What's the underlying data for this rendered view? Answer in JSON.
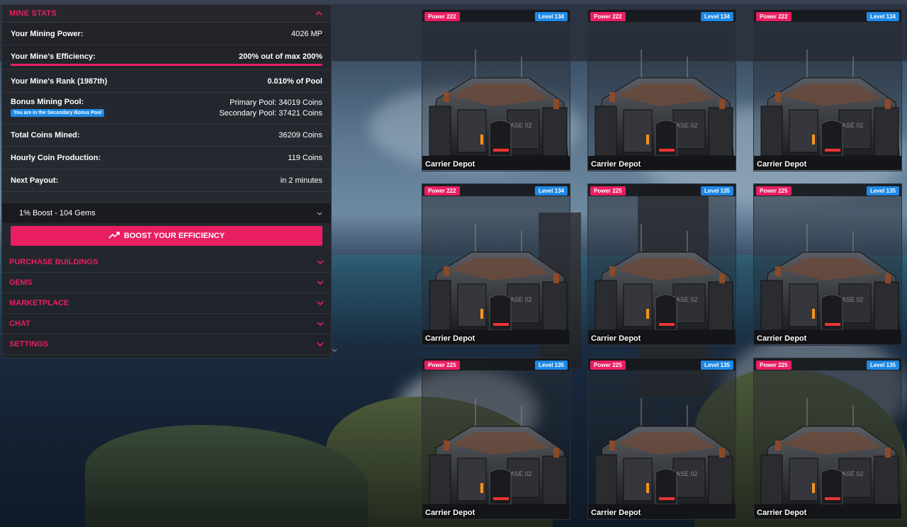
{
  "mine_stats": {
    "header": "MINE STATS",
    "mining_power": {
      "label": "Your Mining Power:",
      "value": "4026 MP"
    },
    "efficiency": {
      "label": "Your Mine's Efficiency:",
      "value": "200% out of max 200%",
      "fill_percent": 100
    },
    "rank": {
      "label": "Your Mine's Rank (1987th)",
      "value": "0.010% of Pool"
    },
    "bonus_pool": {
      "label": "Bonus Mining Pool:",
      "badge": "You are in the Secondary Bonus Pool",
      "primary": "Primary Pool: 34019 Coins",
      "secondary": "Secondary Pool: 37421 Coins"
    },
    "total_coins": {
      "label": "Total Coins Mined:",
      "value": "36209 Coins"
    },
    "hourly": {
      "label": "Hourly Coin Production:",
      "value": "119 Coins"
    },
    "next_payout": {
      "label": "Next Payout:",
      "value": "in 2 minutes"
    },
    "boost_select": "1% Boost - 104 Gems",
    "boost_button": "BOOST YOUR EFFICIENCY"
  },
  "sections": [
    "PURCHASE BUILDINGS",
    "GEMS",
    "MARKETPLACE",
    "CHAT",
    "SETTINGS"
  ],
  "colors": {
    "accent": "#e91e63",
    "level_badge": "#1e88e5"
  },
  "buildings": [
    {
      "power": "Power 222",
      "level": "Level 134",
      "name": "Carrier Depot"
    },
    {
      "power": "Power 222",
      "level": "Level 134",
      "name": "Carrier Depot"
    },
    {
      "power": "Power 222",
      "level": "Level 134",
      "name": "Carrier Depot"
    },
    {
      "power": "Power 222",
      "level": "Level 134",
      "name": "Carrier Depot"
    },
    {
      "power": "Power 225",
      "level": "Level 135",
      "name": "Carrier Depot"
    },
    {
      "power": "Power 225",
      "level": "Level 135",
      "name": "Carrier Depot"
    },
    {
      "power": "Power 225",
      "level": "Level 135",
      "name": "Carrier Depot"
    },
    {
      "power": "Power 225",
      "level": "Level 135",
      "name": "Carrier Depot"
    },
    {
      "power": "Power 225",
      "level": "Level 135",
      "name": "Carrier Depot"
    }
  ]
}
